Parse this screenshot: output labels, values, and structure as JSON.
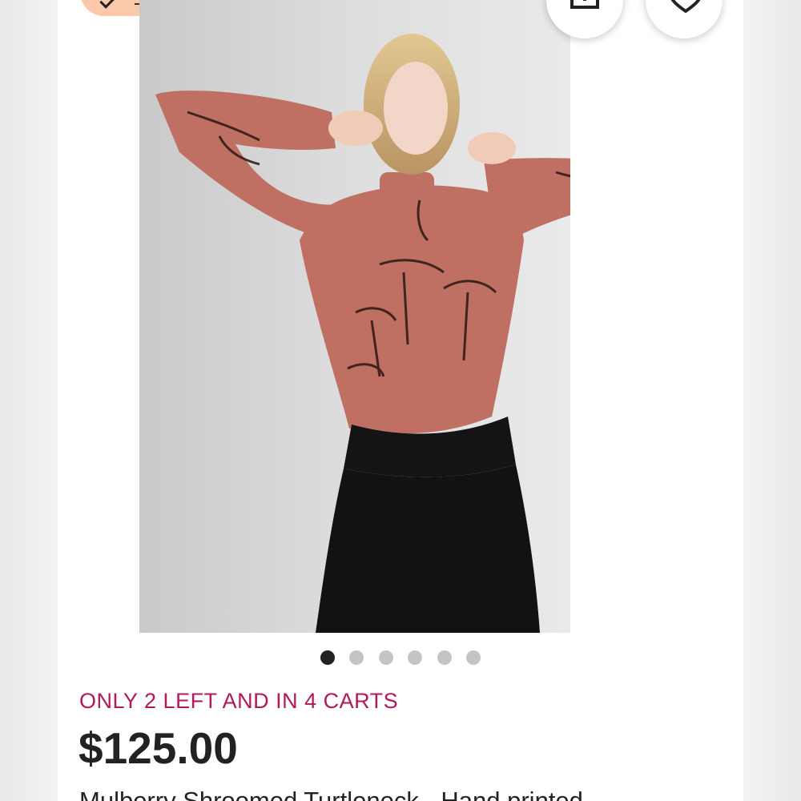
{
  "listing": {
    "stock_notice": "ONLY 2 LEFT AND IN 4 CARTS",
    "price": "$125.00",
    "title": "Mulberry Shroomed Turtleneck - Hand printed"
  },
  "gallery": {
    "image_count": 6,
    "active_index": 0
  },
  "actions": {
    "share_icon": "share-icon",
    "favorite_icon": "heart-icon"
  },
  "colors": {
    "stock_notice": "#b3185a",
    "price": "#222222",
    "chip_background": "#fbc9a9",
    "dot_active": "#222222",
    "dot_inactive": "#c4c4c4"
  }
}
